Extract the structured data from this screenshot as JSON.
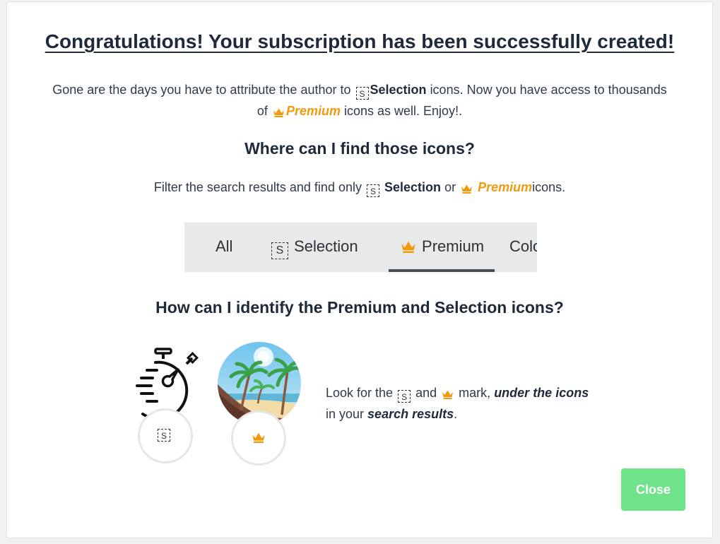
{
  "modal": {
    "title": "Congratulations! Your subscription has been successfully created!",
    "intro": {
      "part1": "Gone are the days you have to attribute the author to",
      "selection": "Selection",
      "part2": "icons. Now you have access to thousands of",
      "premium": "Premium",
      "part3": "icons as well. Enjoy!."
    },
    "find_heading": "Where can I find those icons?",
    "filter": {
      "part1": "Filter the search results and find only",
      "selection": "Selection",
      "or": "or",
      "premium": "Premium",
      "part2": "icons."
    },
    "tabs": [
      {
        "label": "All",
        "active": false
      },
      {
        "label": "Selection",
        "active": false
      },
      {
        "label": "Premium",
        "active": true
      },
      {
        "label": "Colors",
        "active": false
      }
    ],
    "identify_heading": "How can I identify the Premium and Selection icons?",
    "look": {
      "part1": "Look for the",
      "and": "and",
      "mark": "mark,",
      "under": "under the icons",
      "in_your": "in your",
      "search_results": "search results",
      "period": "."
    },
    "selection_badge_letter": "S",
    "close_label": "Close"
  },
  "colors": {
    "premium": "#f19a0e",
    "close_button": "#6ee38a",
    "heading": "#1d2a3a",
    "tab_bar": "#e8e9ea"
  },
  "icons": [
    "crown-icon",
    "selection-s-icon",
    "stopwatch-icon",
    "beach-icon"
  ]
}
